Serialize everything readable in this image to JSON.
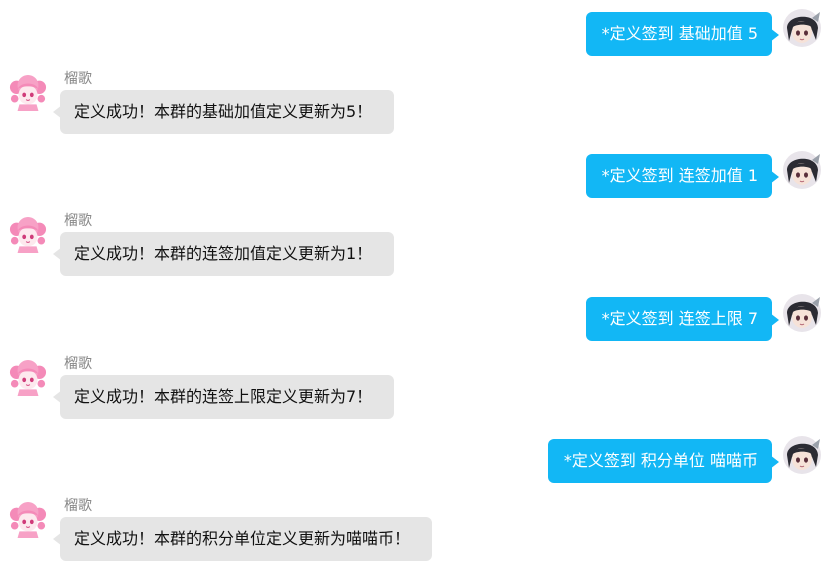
{
  "chat": {
    "bot_name": "榴歌",
    "messages": [
      {
        "from": "me",
        "text": "*定义签到 基础加值 5"
      },
      {
        "from": "bot",
        "sender": "榴歌",
        "text": "定义成功！本群的基础加值定义更新为5！"
      },
      {
        "from": "me",
        "text": "*定义签到 连签加值 1"
      },
      {
        "from": "bot",
        "sender": "榴歌",
        "text": "定义成功！本群的连签加值定义更新为1！"
      },
      {
        "from": "me",
        "text": "*定义签到 连签上限 7"
      },
      {
        "from": "bot",
        "sender": "榴歌",
        "text": "定义成功！本群的连签上限定义更新为7！"
      },
      {
        "from": "me",
        "text": "*定义签到 积分单位 喵喵币"
      },
      {
        "from": "bot",
        "sender": "榴歌",
        "text": "定义成功！本群的积分单位定义更新为喵喵币！"
      }
    ]
  },
  "colors": {
    "outgoing_bubble": "#12b7f5",
    "incoming_bubble": "#e5e5e5",
    "sender_name": "#888888"
  },
  "icons": {
    "user_avatar": "user-avatar-icon",
    "bot_avatar": "bot-avatar-icon"
  }
}
